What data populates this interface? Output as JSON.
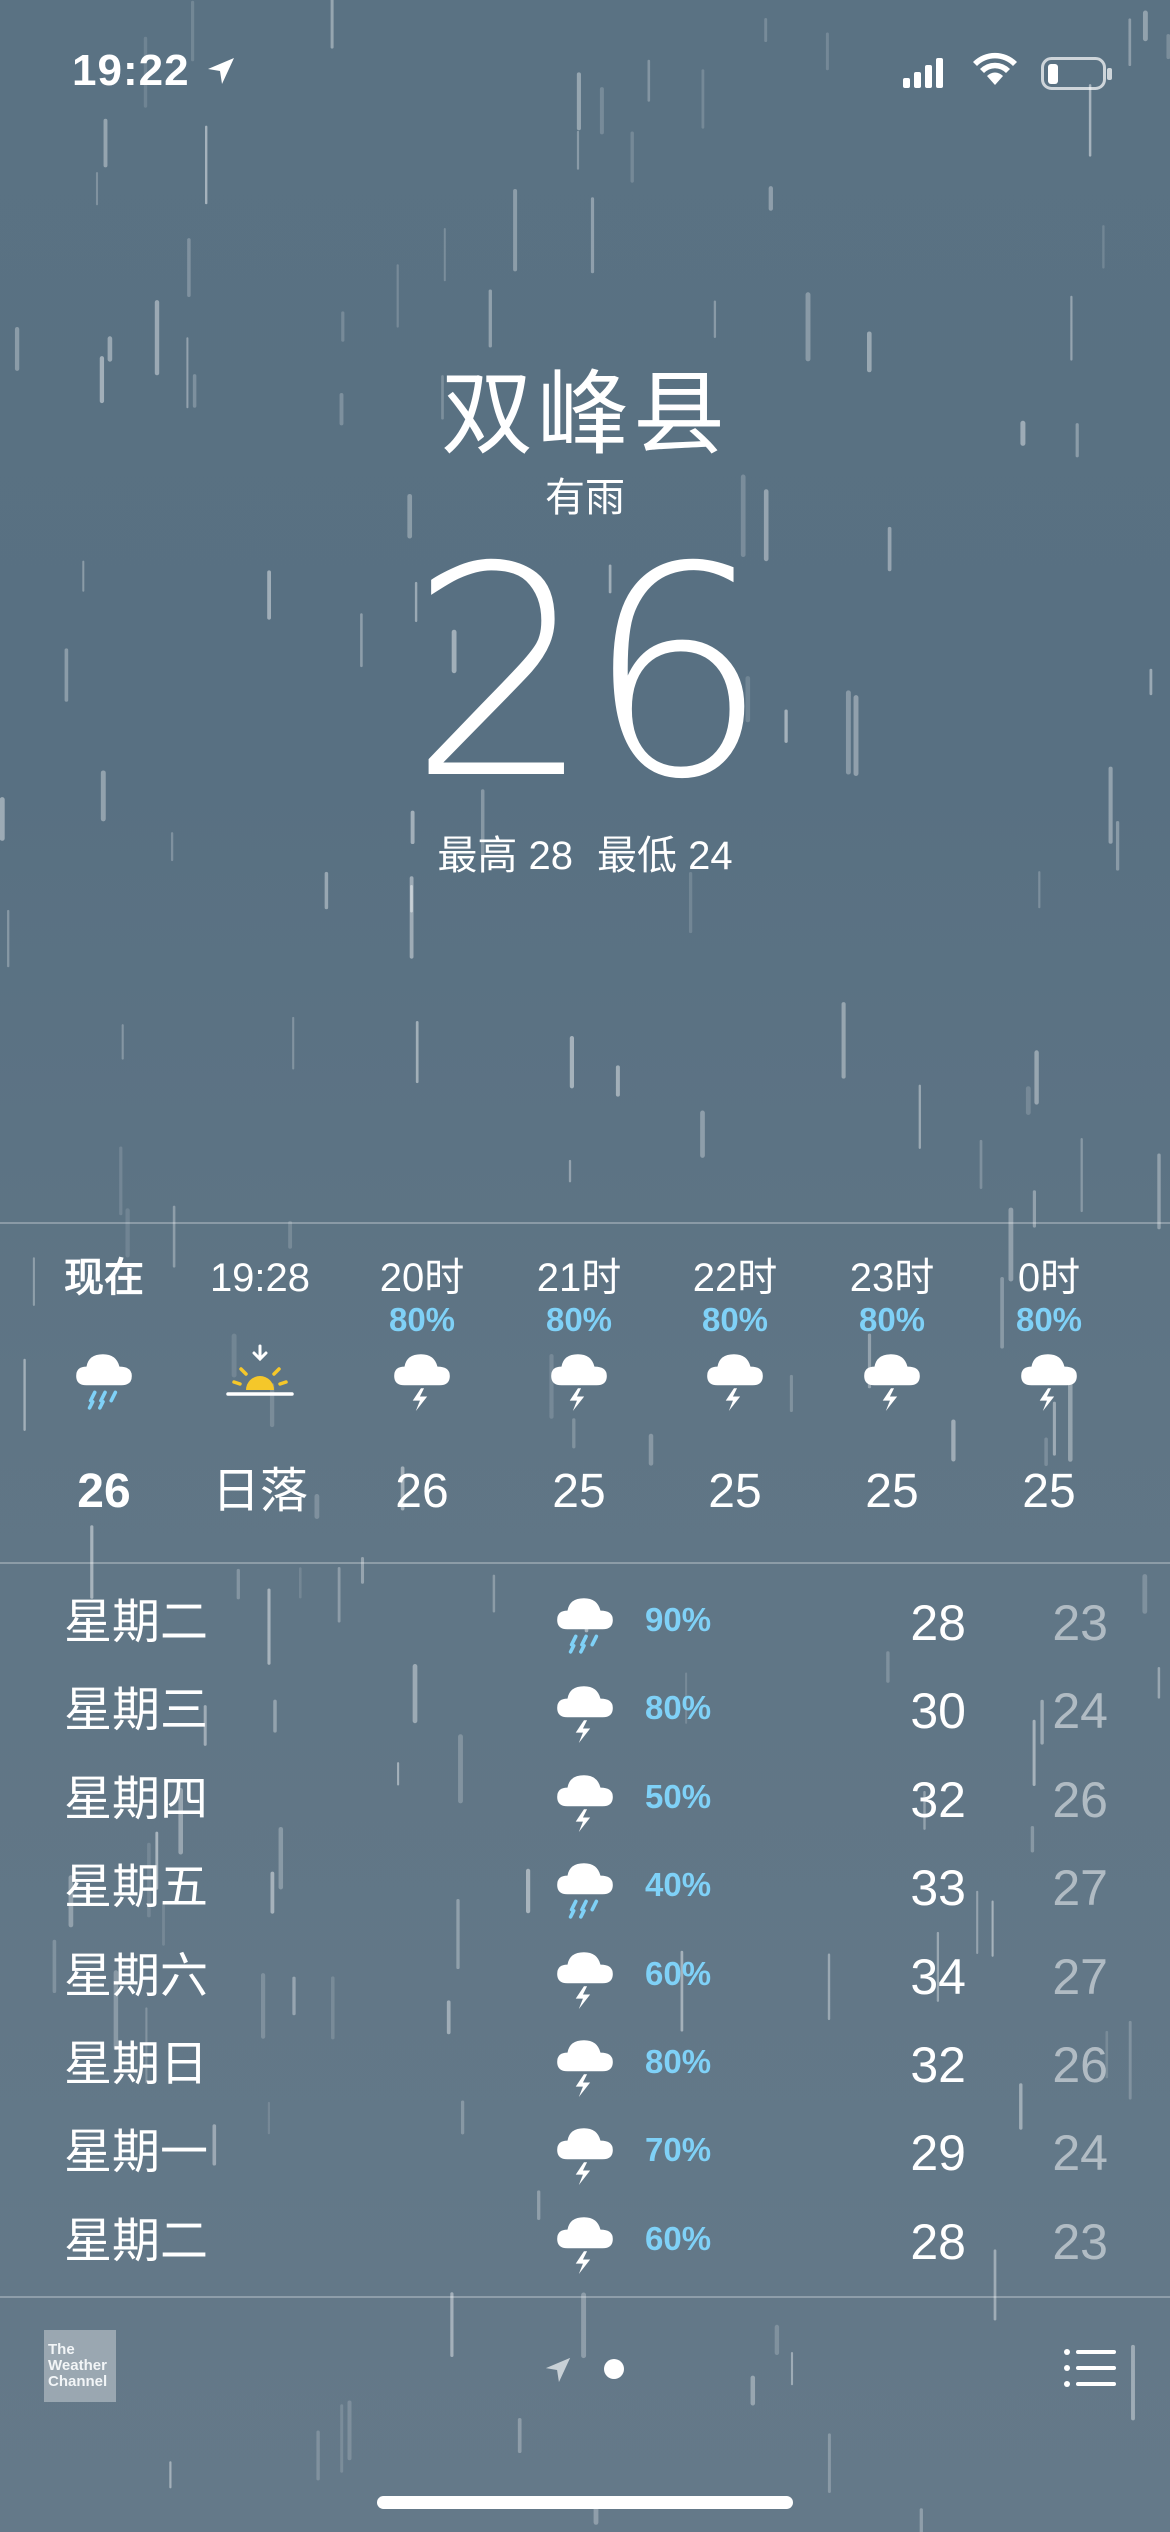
{
  "status_bar": {
    "time": "19:22"
  },
  "header": {
    "city": "双峰县",
    "condition": "有雨",
    "temperature": "26",
    "high": "最高 28",
    "low": "最低 24"
  },
  "hourly": [
    {
      "label": "现在",
      "prob": "",
      "icon": "rain-cloud-icon",
      "value": "26"
    },
    {
      "label": "19:28",
      "prob": "",
      "icon": "sunset-icon",
      "value": "日落"
    },
    {
      "label": "20时",
      "prob": "80%",
      "icon": "thunderstorm-icon",
      "value": "26"
    },
    {
      "label": "21时",
      "prob": "80%",
      "icon": "thunderstorm-icon",
      "value": "25"
    },
    {
      "label": "22时",
      "prob": "80%",
      "icon": "thunderstorm-icon",
      "value": "25"
    },
    {
      "label": "23时",
      "prob": "80%",
      "icon": "thunderstorm-icon",
      "value": "25"
    },
    {
      "label": "0时",
      "prob": "80%",
      "icon": "thunderstorm-icon",
      "value": "25"
    }
  ],
  "daily": [
    {
      "day": "星期二",
      "icon": "rain-cloud-icon",
      "prob": "90%",
      "high": "28",
      "low": "23"
    },
    {
      "day": "星期三",
      "icon": "thunderstorm-icon",
      "prob": "80%",
      "high": "30",
      "low": "24"
    },
    {
      "day": "星期四",
      "icon": "thunderstorm-icon",
      "prob": "50%",
      "high": "32",
      "low": "26"
    },
    {
      "day": "星期五",
      "icon": "rain-cloud-icon",
      "prob": "40%",
      "high": "33",
      "low": "27"
    },
    {
      "day": "星期六",
      "icon": "thunderstorm-icon",
      "prob": "60%",
      "high": "34",
      "low": "27"
    },
    {
      "day": "星期日",
      "icon": "thunderstorm-icon",
      "prob": "80%",
      "high": "32",
      "low": "26"
    },
    {
      "day": "星期一",
      "icon": "thunderstorm-icon",
      "prob": "70%",
      "high": "29",
      "low": "24"
    },
    {
      "day": "星期二",
      "icon": "thunderstorm-icon",
      "prob": "60%",
      "high": "28",
      "low": "23"
    }
  ],
  "footer": {
    "logo_text": "The Weather Channel"
  },
  "colors": {
    "accent_prob": "#7fd1f7",
    "sun": "#f5c72a"
  }
}
